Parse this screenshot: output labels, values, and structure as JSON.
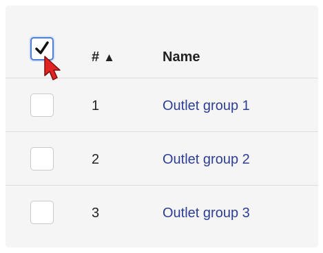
{
  "table": {
    "header": {
      "number_label": "#",
      "sort_indicator": "▲",
      "name_label": "Name",
      "select_all_checked": true
    },
    "rows": [
      {
        "number": "1",
        "name": "Outlet group 1",
        "checked": false
      },
      {
        "number": "2",
        "name": "Outlet group 2",
        "checked": false
      },
      {
        "number": "3",
        "name": "Outlet group 3",
        "checked": false
      }
    ]
  },
  "colors": {
    "link": "#2c3e93",
    "focus_border": "#4f7fd1",
    "cursor": "#e02424"
  },
  "icons": {
    "select_all": "checkmark-icon",
    "pointer": "mouse-pointer-icon",
    "sort": "sort-ascending-icon"
  }
}
